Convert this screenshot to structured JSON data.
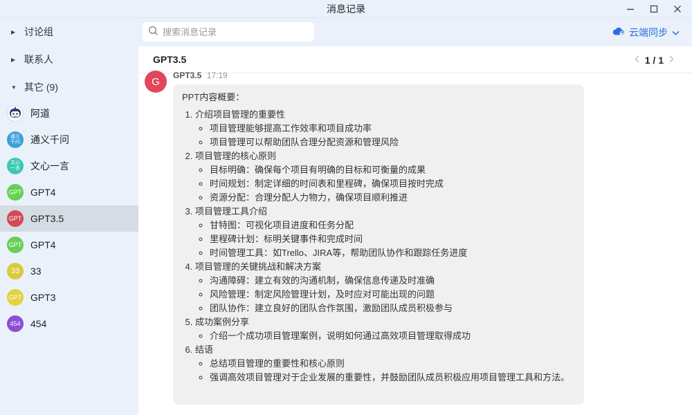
{
  "window": {
    "title": "消息记录"
  },
  "sidebar": {
    "groups": [
      {
        "label": "讨论组",
        "expanded": false
      },
      {
        "label": "联系人",
        "expanded": false
      },
      {
        "label": "其它 (9)",
        "expanded": true
      }
    ],
    "contacts": [
      {
        "name": "阿道",
        "avatar_text": "",
        "avatar_color": "#ffffff",
        "active": false
      },
      {
        "name": "通义千问",
        "avatar_text": "通义千问",
        "avatar_color": "#3aa0d8",
        "active": false
      },
      {
        "name": "文心一言",
        "avatar_text": "文心一言",
        "avatar_color": "#3cc7b2",
        "active": false
      },
      {
        "name": "GPT4",
        "avatar_text": "GPT",
        "avatar_color": "#67cf55",
        "active": false
      },
      {
        "name": "GPT3.5",
        "avatar_text": "GPT",
        "avatar_color": "#d24a55",
        "active": true
      },
      {
        "name": "GPT4",
        "avatar_text": "GPT",
        "avatar_color": "#67cf55",
        "active": false
      },
      {
        "name": "33",
        "avatar_text": "33",
        "avatar_color": "#d9c93c",
        "active": false
      },
      {
        "name": "GPT3",
        "avatar_text": "GPT",
        "avatar_color": "#e3d23c",
        "active": false
      },
      {
        "name": "454",
        "avatar_text": "454",
        "avatar_color": "#8d4fd6",
        "active": false
      }
    ]
  },
  "search": {
    "placeholder": "搜索消息记录",
    "value": ""
  },
  "sync": {
    "label": "云端同步",
    "color": "#2a6fdb"
  },
  "chat": {
    "title": "GPT3.5",
    "pager": "1 / 1"
  },
  "message": {
    "avatar_text": "G",
    "avatar_color": "#e0475b",
    "sender": "GPT3.5",
    "time": "17:19",
    "intro": "PPT内容概要：",
    "sections": [
      {
        "title": "介绍项目管理的重要性",
        "items": [
          "项目管理能够提高工作效率和项目成功率",
          "项目管理可以帮助团队合理分配资源和管理风险"
        ]
      },
      {
        "title": "项目管理的核心原则",
        "items": [
          "目标明确：确保每个项目有明确的目标和可衡量的成果",
          "时间规划：制定详细的时间表和里程碑，确保项目按时完成",
          "资源分配：合理分配人力物力，确保项目顺利推进"
        ]
      },
      {
        "title": "项目管理工具介绍",
        "items": [
          "甘特图：可视化项目进度和任务分配",
          "里程碑计划：标明关键事件和完成时间",
          "时间管理工具：如Trello、JIRA等，帮助团队协作和跟踪任务进度"
        ]
      },
      {
        "title": "项目管理的关键挑战和解决方案",
        "items": [
          "沟通障碍：建立有效的沟通机制，确保信息传递及时准确",
          "风险管理：制定风险管理计划，及时应对可能出现的问题",
          "团队协作：建立良好的团队合作氛围，激励团队成员积极参与"
        ]
      },
      {
        "title": "成功案例分享",
        "items": [
          "介绍一个成功项目管理案例，说明如何通过高效项目管理取得成功"
        ]
      },
      {
        "title": "结语",
        "items": [
          "总结项目管理的重要性和核心原则",
          "强调高效项目管理对于企业发展的重要性，并鼓励团队成员积极应用项目管理工具和方法。"
        ]
      }
    ]
  }
}
